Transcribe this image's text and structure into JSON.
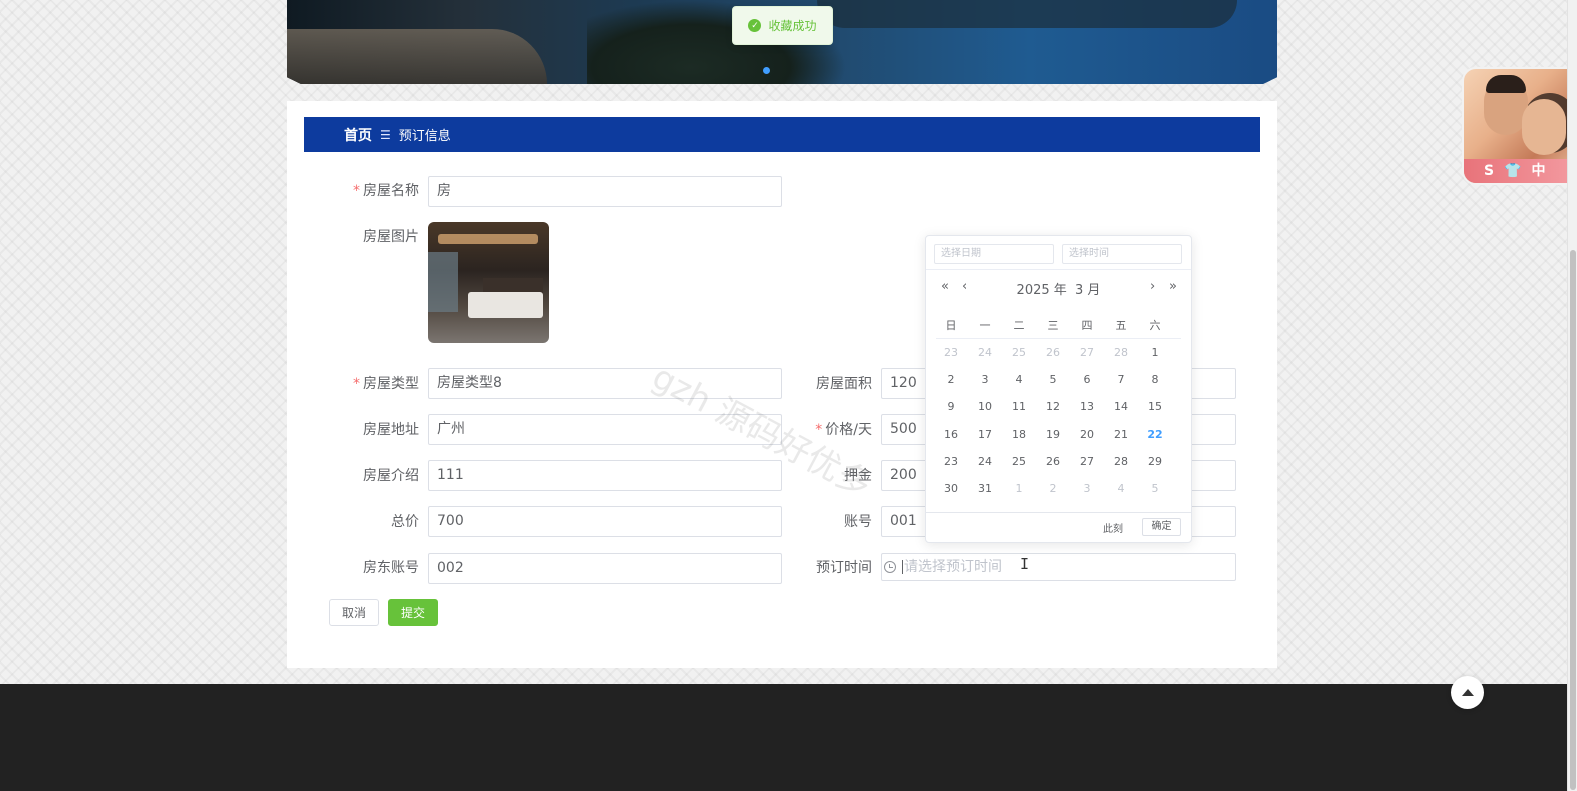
{
  "toast": {
    "text": "收藏成功"
  },
  "breadcrumb": {
    "home": "首页",
    "separator": "☰",
    "current": "预订信息"
  },
  "form": {
    "required_mark": "*",
    "house_name": {
      "label": "房屋名称",
      "value": "房"
    },
    "house_image": {
      "label": "房屋图片"
    },
    "house_type": {
      "label": "房屋类型",
      "value": "房屋类型8"
    },
    "house_area": {
      "label": "房屋面积",
      "value": "120"
    },
    "house_address": {
      "label": "房屋地址",
      "value": "广州"
    },
    "price_per_day": {
      "label": "价格/天",
      "value": "500"
    },
    "house_intro": {
      "label": "房屋介绍",
      "value": "111"
    },
    "deposit": {
      "label": "押金",
      "value": "200"
    },
    "total_price": {
      "label": "总价",
      "value": "700"
    },
    "account": {
      "label": "账号",
      "value": "001"
    },
    "landlord_account": {
      "label": "房东账号",
      "value": "002"
    },
    "booking_time": {
      "label": "预订时间",
      "placeholder": "请选择预订时间",
      "value": ""
    },
    "cancel_label": "取消",
    "submit_label": "提交"
  },
  "datepicker": {
    "date_placeholder": "选择日期",
    "time_placeholder": "选择时间",
    "year_label": "2025 年",
    "month_label": "3 月",
    "prev_year": "«",
    "prev_month": "‹",
    "next_month": "›",
    "next_year": "»",
    "weekdays": [
      "日",
      "一",
      "二",
      "三",
      "四",
      "五",
      "六"
    ],
    "weeks": [
      [
        "23",
        "24",
        "25",
        "26",
        "27",
        "28",
        "1"
      ],
      [
        "2",
        "3",
        "4",
        "5",
        "6",
        "7",
        "8"
      ],
      [
        "9",
        "10",
        "11",
        "12",
        "13",
        "14",
        "15"
      ],
      [
        "16",
        "17",
        "18",
        "19",
        "20",
        "21",
        "22"
      ],
      [
        "23",
        "24",
        "25",
        "26",
        "27",
        "28",
        "29"
      ],
      [
        "30",
        "31",
        "1",
        "2",
        "3",
        "4",
        "5"
      ]
    ],
    "today": "22",
    "now_label": "此刻",
    "confirm_label": "确定"
  },
  "watermark": "gzh 源码好优多",
  "colors": {
    "header": "#0d3b9e",
    "submit": "#67c23a",
    "today": "#409eff",
    "toast": "#67c23a"
  }
}
